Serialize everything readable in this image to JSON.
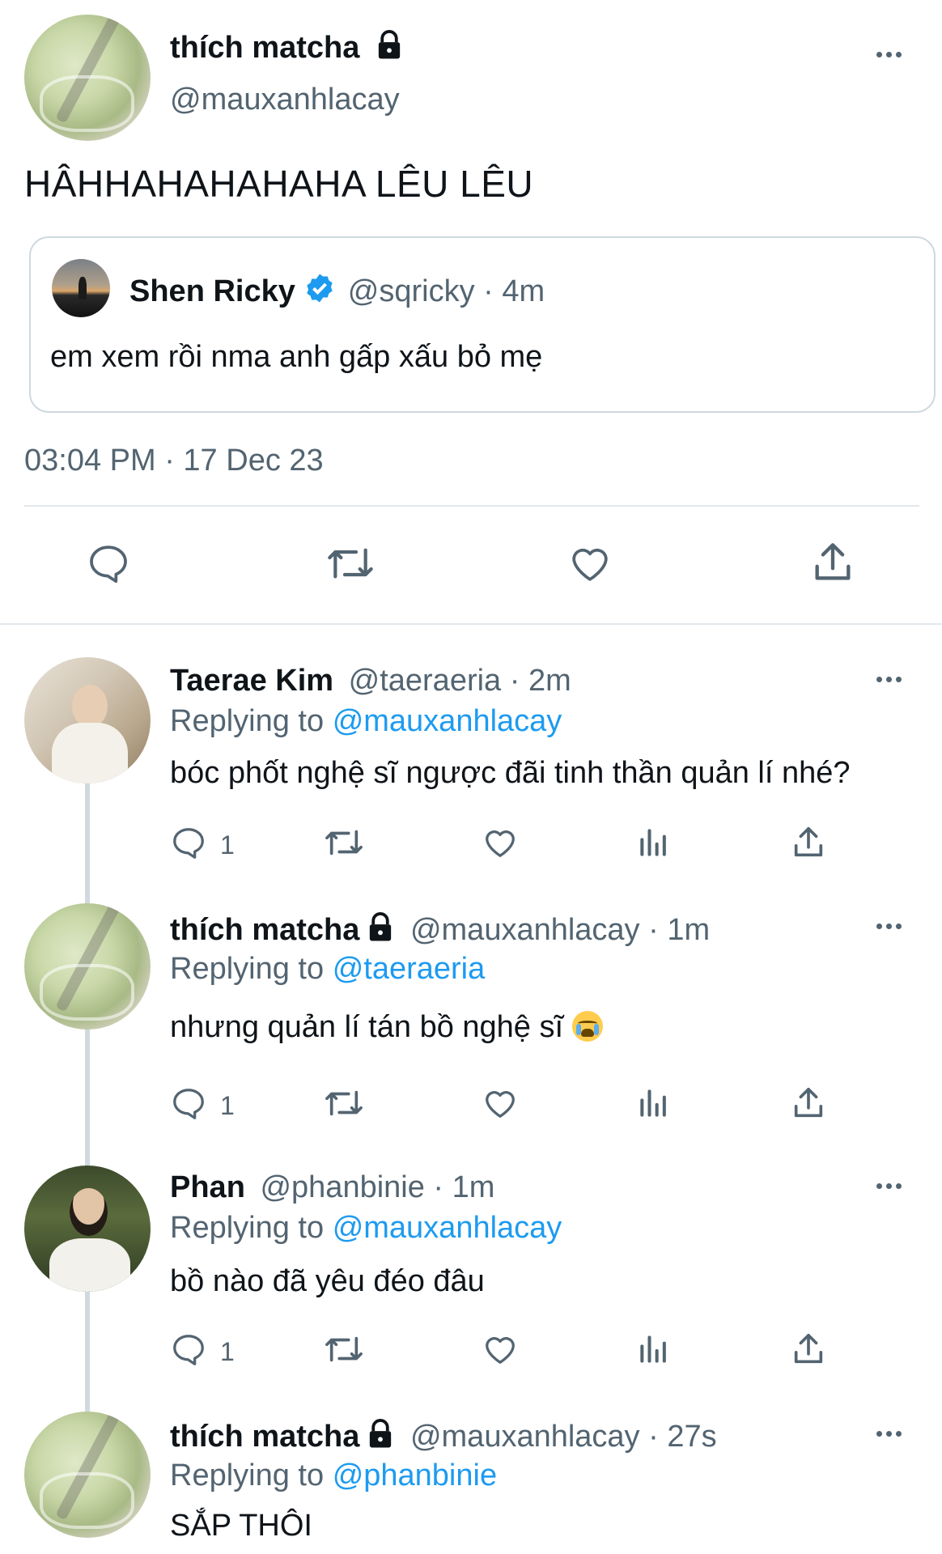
{
  "main_tweet": {
    "author_name": "thích matcha",
    "author_handle": "@mauxanhlacay",
    "text": "HÂHHAHAHAHAHA LÊU LÊU",
    "quoted": {
      "name": "Shen Ricky",
      "handle_time": "@sqricky · 4m",
      "text": "em xem rồi nma anh gấp xấu bỏ mẹ"
    },
    "timestamp": "03:04 PM · 17 Dec 23"
  },
  "replies": [
    {
      "name": "Taerae Kim",
      "handle_time": "@taeraeria · 2m",
      "replying_prefix": "Replying to",
      "replying_to": "@mauxanhlacay",
      "text": "bóc phốt nghệ sĩ ngược đãi tinh thần quản lí nhé?",
      "reply_count": "1",
      "avatar": "avatar-taerae"
    },
    {
      "name": "thích matcha",
      "handle_time": "@mauxanhlacay · 1m",
      "replying_prefix": "Replying to",
      "replying_to": "@taeraeria",
      "text": "nhưng quản lí tán bồ nghệ sĩ",
      "reply_count": "1",
      "avatar": "avatar-matcha"
    },
    {
      "name": "Phan",
      "handle_time": "@phanbinie · 1m",
      "replying_prefix": "Replying to",
      "replying_to": "@mauxanhlacay",
      "text": "bồ nào đã yêu đéo đâu",
      "reply_count": "1",
      "avatar": "avatar-phan"
    },
    {
      "name": "thích matcha",
      "handle_time": "@mauxanhlacay · 27s",
      "replying_prefix": "Replying to",
      "replying_to": "@phanbinie",
      "text": "SẮP THÔI",
      "avatar": "avatar-matcha"
    }
  ],
  "icons": {
    "more": "more-horizontal-icon",
    "lock": "lock-icon",
    "verified": "verified-badge-icon",
    "reply": "reply-icon",
    "retweet": "retweet-icon",
    "like": "heart-icon",
    "views": "analytics-icon",
    "share": "share-icon"
  },
  "colors": {
    "text_primary": "#0f1419",
    "text_secondary": "#536471",
    "link": "#1d9bf0",
    "border": "#cfd9de",
    "verified": "#1d9bf0"
  }
}
